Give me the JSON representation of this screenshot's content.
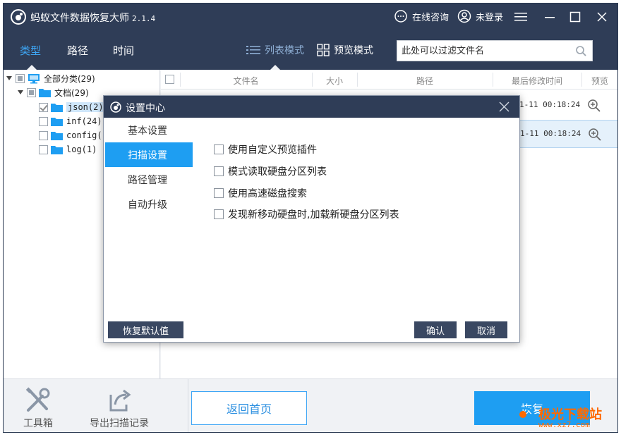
{
  "app": {
    "title": "蚂蚁文件数据恢复大师",
    "version": "2.1.4",
    "online_consult": "在线咨询",
    "login_status": "未登录"
  },
  "nav": {
    "tabs": [
      {
        "label": "类型",
        "active": true
      },
      {
        "label": "路径",
        "active": false
      },
      {
        "label": "时间",
        "active": false
      }
    ],
    "list_mode": "列表模式",
    "preview_mode": "预览模式"
  },
  "search": {
    "placeholder": "此处可以过滤文件名"
  },
  "tree": {
    "root": "全部分类(29)",
    "docs": "文档(29)",
    "items": [
      "json(2)",
      "inf(24)",
      "config(",
      "log(1)"
    ]
  },
  "filelist": {
    "headers": [
      "文件名",
      "大小",
      "路径",
      "最后修改时间",
      "预览"
    ],
    "rows": [
      {
        "date": "1-11 00:18:24"
      },
      {
        "date": "1-11 00:18:24"
      }
    ]
  },
  "bottom": {
    "toolbox": "工具箱",
    "export": "导出扫描记录",
    "home": "返回首页",
    "recover": "恢复"
  },
  "watermark": {
    "text": "极光下载站",
    "url": "www.xz7.com"
  },
  "modal": {
    "title": "设置中心",
    "menu": [
      {
        "label": "基本设置",
        "active": false
      },
      {
        "label": "扫描设置",
        "active": true
      },
      {
        "label": "路径管理",
        "active": false
      },
      {
        "label": "自动升级",
        "active": false
      }
    ],
    "options": [
      "使用自定义预览插件",
      "模式读取硬盘分区列表",
      "使用高速磁盘搜索",
      "发现新移动硬盘时,加载新硬盘分区列表"
    ],
    "restore_default": "恢复默认值",
    "confirm": "确认",
    "cancel": "取消"
  },
  "colors": {
    "titlebar": "#2f3d57",
    "accent": "#1e9ef2",
    "active_tab": "#3ea6f5"
  }
}
